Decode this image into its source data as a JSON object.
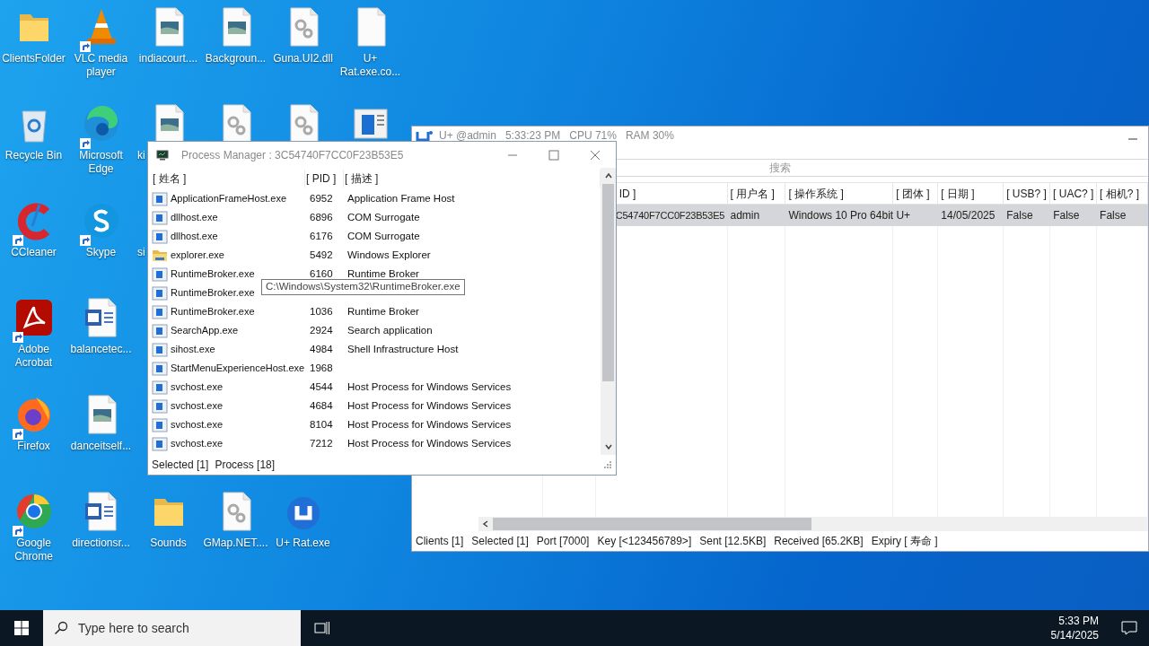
{
  "desktop": {
    "rows": [
      [
        {
          "label": "ClientsFolder",
          "kind": "folder"
        },
        {
          "label": "VLC media player",
          "kind": "vlc",
          "shortcut": true
        },
        {
          "label": "indiacourt....",
          "kind": "image"
        },
        {
          "label": "Backgroun...",
          "kind": "image"
        },
        {
          "label": "Guna.UI2.dll",
          "kind": "gear"
        },
        {
          "label": "U+ Rat.exe.co...",
          "kind": "blank"
        }
      ],
      [
        {
          "label": "Recycle Bin",
          "kind": "recycle"
        },
        {
          "label": "Microsoft Edge",
          "kind": "edge",
          "shortcut": true
        },
        {
          "label": "ki",
          "kind": "image",
          "cut": true
        },
        {
          "kind": "gear"
        },
        {
          "kind": "gear"
        },
        {
          "kind": "appwindow"
        }
      ],
      [
        {
          "label": "CCleaner",
          "kind": "ccleaner",
          "shortcut": true
        },
        {
          "label": "Skype",
          "kind": "skype",
          "shortcut": true
        },
        {
          "label": "si",
          "cut": true
        }
      ],
      [
        {
          "label": "Adobe Acrobat",
          "kind": "acrobat",
          "shortcut": true
        },
        {
          "label": "balancetec...",
          "kind": "word"
        }
      ],
      [
        {
          "label": "Firefox",
          "kind": "firefox",
          "shortcut": true
        },
        {
          "label": "danceitself...",
          "kind": "image"
        }
      ],
      [
        {
          "label": "Google Chrome",
          "kind": "chrome",
          "shortcut": true
        },
        {
          "label": "directionsr...",
          "kind": "word"
        },
        {
          "label": "Sounds",
          "kind": "folder"
        },
        {
          "label": "GMap.NET....",
          "kind": "gear"
        },
        {
          "label": "U+ Rat.exe",
          "kind": "urat"
        }
      ]
    ]
  },
  "main_window": {
    "title": "U+ @admin   5:33:23 PM   CPU 71%   RAM 30%",
    "search": {
      "placeholder": "搜索"
    },
    "columns": [
      "ID ]",
      "[ 用户名 ]",
      "[ 操作系统 ]",
      "[ 团体 ]",
      "[ 日期 ]",
      "[ USB? ]",
      "[ UAC? ]",
      "[ 相机? ]"
    ],
    "rows": [
      {
        "selected": true,
        "cells": [
          "C54740F7CC0F23B53E5",
          "admin",
          "Windows 10 Pro 64bit",
          "U+",
          "14/05/2025",
          "False",
          "False",
          "False"
        ]
      }
    ],
    "status_bar": [
      "Clients [1]",
      "Selected [1]",
      "Port [7000]",
      "Key [<123456789>]",
      "Sent [12.5KB]",
      "Received [65.2KB]",
      "Expiry [ 寿命 ]"
    ]
  },
  "process_window": {
    "title": "Process Manager : 3C54740F7CC0F23B53E5",
    "columns": [
      "[ 姓名 ]",
      "[ PID ]",
      "[ 描述 ]"
    ],
    "rows": [
      {
        "name": "ApplicationFrameHost.exe",
        "kind": "app",
        "pid": "6952",
        "description": "Application Frame Host"
      },
      {
        "name": "dllhost.exe",
        "kind": "app",
        "pid": "6896",
        "description": "COM Surrogate"
      },
      {
        "name": "dllhost.exe",
        "kind": "app",
        "pid": "6176",
        "description": "COM Surrogate"
      },
      {
        "name": "explorer.exe",
        "kind": "folder",
        "pid": "5492",
        "description": "Windows Explorer"
      },
      {
        "name": "RuntimeBroker.exe",
        "kind": "app",
        "pid": "6160",
        "description": "Runtime Broker"
      },
      {
        "name": "RuntimeBroker.exe",
        "kind": "app"
      },
      {
        "name": "RuntimeBroker.exe",
        "kind": "app",
        "pid": "1036",
        "description": "Runtime Broker"
      },
      {
        "name": "SearchApp.exe",
        "kind": "app",
        "pid": "2924",
        "description": "Search application"
      },
      {
        "name": "sihost.exe",
        "kind": "app",
        "pid": "4984",
        "description": "Shell Infrastructure Host"
      },
      {
        "name": "StartMenuExperienceHost.exe",
        "kind": "app",
        "pid": "1968"
      },
      {
        "name": "svchost.exe",
        "kind": "app",
        "pid": "4544",
        "description": "Host Process for Windows Services"
      },
      {
        "name": "svchost.exe",
        "kind": "app",
        "pid": "4684",
        "description": "Host Process for Windows Services"
      },
      {
        "name": "svchost.exe",
        "kind": "app",
        "pid": "8104",
        "description": "Host Process for Windows Services"
      },
      {
        "name": "svchost.exe",
        "kind": "app",
        "pid": "7212",
        "description": "Host Process for Windows Services"
      }
    ],
    "tooltip": "C:\\Windows\\System32\\RuntimeBroker.exe",
    "status": [
      "Selected [1]",
      "Process [18]"
    ]
  },
  "taskbar": {
    "search": {
      "placeholder": "Type here to search"
    },
    "time": "5:33 PM",
    "date": "5/14/2025"
  }
}
